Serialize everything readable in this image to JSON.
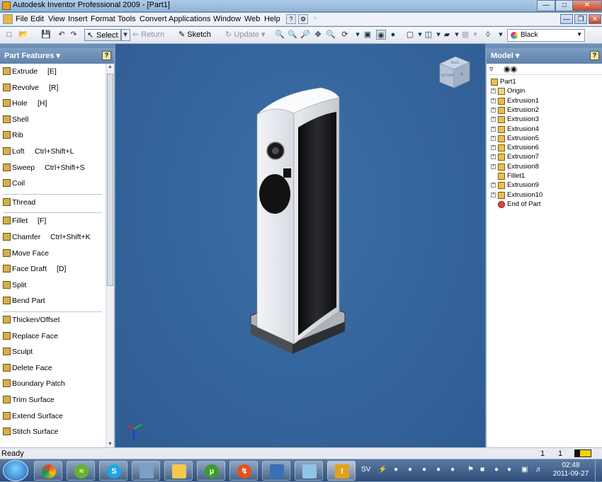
{
  "window": {
    "title": "Autodesk Inventor Professional 2009 - [Part1]"
  },
  "menubar": {
    "items": [
      "File",
      "Edit",
      "View",
      "Insert",
      "Format",
      "Tools",
      "Convert",
      "Applications",
      "Window",
      "Web",
      "Help"
    ]
  },
  "toolbar": {
    "select_label": "Select",
    "return_label": "Return",
    "sketch_label": "Sketch",
    "update_label": "Update",
    "color_value": "Black"
  },
  "left_panel": {
    "title": "Part Features ▾",
    "features": [
      {
        "label": "Extrude",
        "shortcut": "[E]"
      },
      {
        "label": "Revolve",
        "shortcut": "[R]"
      },
      {
        "label": "Hole",
        "shortcut": "[H]"
      },
      {
        "label": "Shell",
        "shortcut": ""
      },
      {
        "label": "Rib",
        "shortcut": ""
      },
      {
        "label": "Loft",
        "shortcut": "Ctrl+Shift+L"
      },
      {
        "label": "Sweep",
        "shortcut": "Ctrl+Shift+S"
      },
      {
        "label": "Coil",
        "shortcut": ""
      },
      {
        "label": "Thread",
        "shortcut": ""
      },
      {
        "label": "Fillet",
        "shortcut": "[F]"
      },
      {
        "label": "Chamfer",
        "shortcut": "Ctrl+Shift+K"
      },
      {
        "label": "Move Face",
        "shortcut": ""
      },
      {
        "label": "Face Draft",
        "shortcut": "[D]"
      },
      {
        "label": "Split",
        "shortcut": ""
      },
      {
        "label": "Bend Part",
        "shortcut": ""
      },
      {
        "label": "Thicken/Offset",
        "shortcut": ""
      },
      {
        "label": "Replace Face",
        "shortcut": ""
      },
      {
        "label": "Sculpt",
        "shortcut": ""
      },
      {
        "label": "Delete Face",
        "shortcut": ""
      },
      {
        "label": "Boundary Patch",
        "shortcut": ""
      },
      {
        "label": "Trim Surface",
        "shortcut": ""
      },
      {
        "label": "Extend Surface",
        "shortcut": ""
      },
      {
        "label": "Stitch Surface",
        "shortcut": ""
      }
    ]
  },
  "viewcube": {
    "face_top": "BACK",
    "face_front": "BOTTOM",
    "face_side": "R"
  },
  "right_panel": {
    "title": "Model ▾",
    "tree": [
      {
        "label": "Part1",
        "level": 0,
        "expandable": false,
        "icon": "part"
      },
      {
        "label": "Origin",
        "level": 1,
        "expandable": true,
        "icon": "folder"
      },
      {
        "label": "Extrusion1",
        "level": 1,
        "expandable": true,
        "icon": "feature"
      },
      {
        "label": "Extrusion2",
        "level": 1,
        "expandable": true,
        "icon": "feature"
      },
      {
        "label": "Extrusion3",
        "level": 1,
        "expandable": true,
        "icon": "feature"
      },
      {
        "label": "Extrusion4",
        "level": 1,
        "expandable": true,
        "icon": "feature"
      },
      {
        "label": "Extrusion5",
        "level": 1,
        "expandable": true,
        "icon": "feature"
      },
      {
        "label": "Extrusion6",
        "level": 1,
        "expandable": true,
        "icon": "feature"
      },
      {
        "label": "Extrusion7",
        "level": 1,
        "expandable": true,
        "icon": "feature"
      },
      {
        "label": "Extrusion8",
        "level": 1,
        "expandable": true,
        "icon": "feature"
      },
      {
        "label": "Fillet1",
        "level": 1,
        "expandable": false,
        "icon": "feature"
      },
      {
        "label": "Extrusion9",
        "level": 1,
        "expandable": true,
        "icon": "feature"
      },
      {
        "label": "Extrusion10",
        "level": 1,
        "expandable": true,
        "icon": "feature"
      },
      {
        "label": "End of Part",
        "level": 1,
        "expandable": false,
        "icon": "end"
      }
    ]
  },
  "statusbar": {
    "text": "Ready",
    "num1": "1",
    "num2": "1"
  },
  "taskbar": {
    "language": "SV",
    "time": "02:48",
    "date": "2011-09-27",
    "apps": [
      "chrome",
      "spotify",
      "skype",
      "remote-desktop",
      "explorer",
      "utorrent",
      "flash",
      "computer",
      "notes",
      "inventor"
    ]
  }
}
